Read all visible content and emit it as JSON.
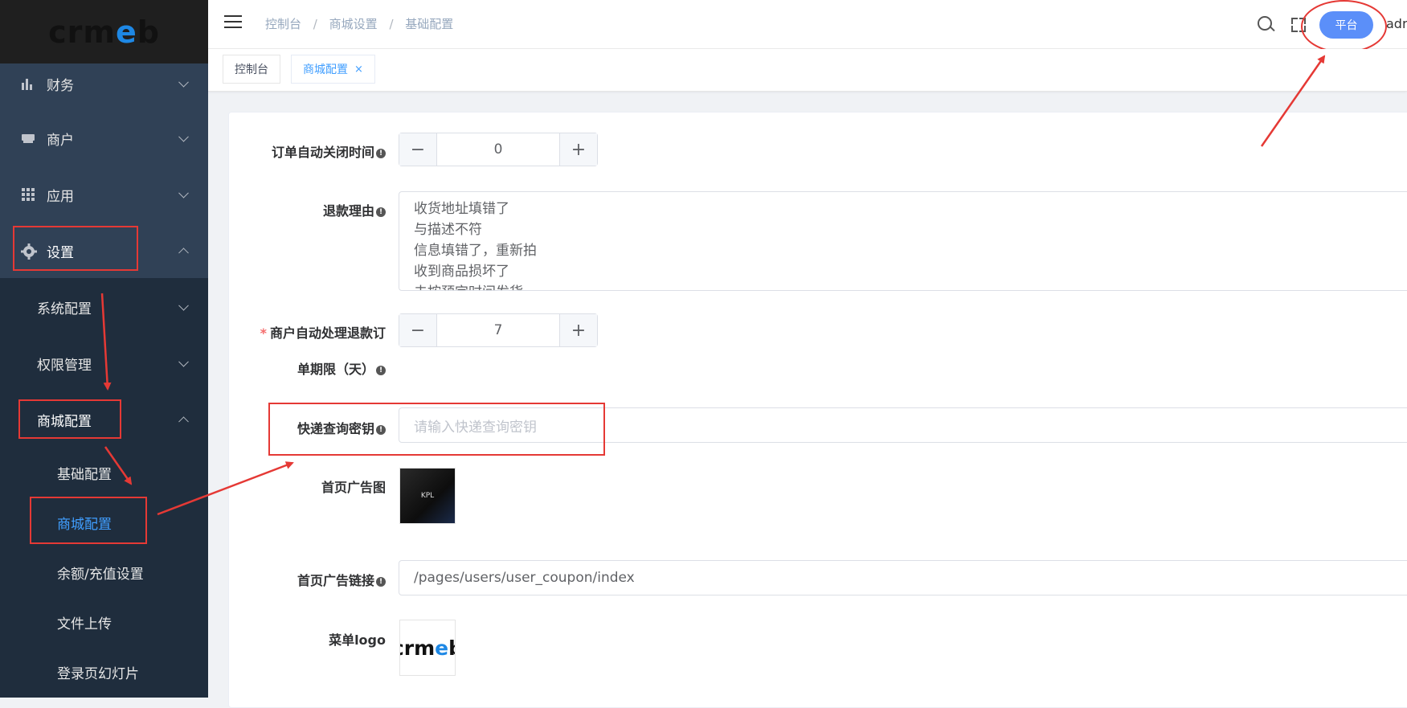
{
  "logo": {
    "text_a": "crm",
    "text_b": "e",
    "text_c": "b"
  },
  "sidebar": {
    "items": [
      {
        "label": "财务",
        "icon": "bar-chart-icon"
      },
      {
        "label": "商户",
        "icon": "store-icon"
      },
      {
        "label": "应用",
        "icon": "grid-icon"
      },
      {
        "label": "设置",
        "icon": "gear-icon"
      }
    ],
    "sub_items": [
      {
        "label": "系统配置"
      },
      {
        "label": "权限管理"
      },
      {
        "label": "商城配置"
      }
    ],
    "sub2_items": [
      {
        "label": "基础配置"
      },
      {
        "label": "商城配置"
      },
      {
        "label": "余额/充值设置"
      },
      {
        "label": "文件上传"
      },
      {
        "label": "登录页幻灯片"
      }
    ]
  },
  "header": {
    "breadcrumb": [
      "控制台",
      "商城设置",
      "基础配置"
    ],
    "sep": "/",
    "platform_button": "平台",
    "user": "adr"
  },
  "tabs": [
    {
      "label": "控制台"
    },
    {
      "label": "商城配置",
      "close": "×"
    }
  ],
  "form": {
    "order_close": {
      "label": "订单自动关闭时间",
      "value": "0"
    },
    "refund_reason": {
      "label": "退款理由",
      "lines": [
        "收货地址填错了",
        "与描述不符",
        "信息填错了，重新拍",
        "收到商品损坏了",
        "未按预定时间发货"
      ]
    },
    "auto_refund": {
      "label_line1": "商户自动处理退款订",
      "label_line2": "单期限（天）",
      "value": "7"
    },
    "express_key": {
      "label": "快递查询密钥",
      "placeholder": "请输入快递查询密钥"
    },
    "home_ad_image": {
      "label": "首页广告图",
      "thumb_text": "KPL"
    },
    "home_ad_link": {
      "label": "首页广告链接",
      "value": "/pages/users/user_coupon/index"
    },
    "menu_logo": {
      "label": "菜单logo"
    }
  },
  "icons": {
    "info": "!",
    "minus": "−",
    "plus": "+"
  }
}
